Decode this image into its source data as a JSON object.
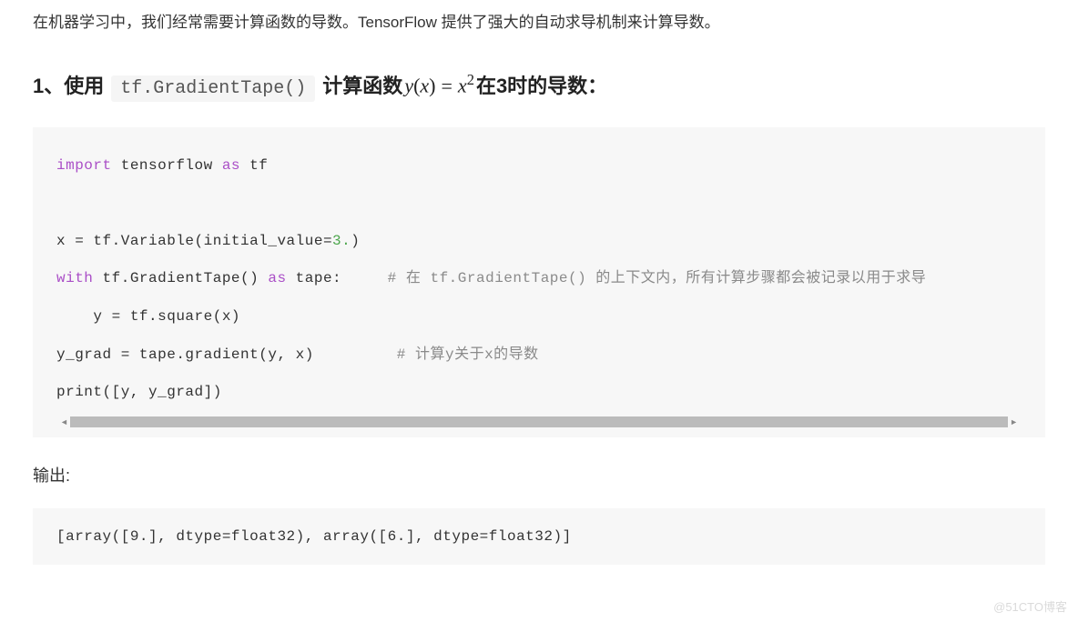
{
  "intro": "在机器学习中，我们经常需要计算函数的导数。TensorFlow 提供了强大的自动求导机制来计算导数。",
  "heading": {
    "prefix": "1、使用 ",
    "inline_code": "tf.GradientTape()",
    "mid1": " 计算函数",
    "math_y": "y",
    "math_x1": "x",
    "math_x2": "x",
    "math_exp": "2",
    "suffix": "在3时的导数："
  },
  "code": {
    "l1_import": "import",
    "l1_mod": " tensorflow ",
    "l1_as": "as",
    "l1_alias": " tf",
    "blank": " ",
    "l3_pre": "x = tf.Variable(initial_value=",
    "l3_num": "3.",
    "l3_post": ")",
    "l4_with": "with",
    "l4_mid": " tf.GradientTape() ",
    "l4_as": "as",
    "l4_post": " tape:     ",
    "l4_comment": "# 在 tf.GradientTape() 的上下文内，所有计算步骤都会被记录以用于求导",
    "l5": "    y = tf.square(x)",
    "l6_pre": "y_grad = tape.gradient(y, x)         ",
    "l6_comment": "# 计算y关于x的导数",
    "l7": "print([y, y_grad])"
  },
  "output_label": "输出:",
  "output": "[array([9.], dtype=float32), array([6.], dtype=float32)]",
  "watermark": "@51CTO博客"
}
